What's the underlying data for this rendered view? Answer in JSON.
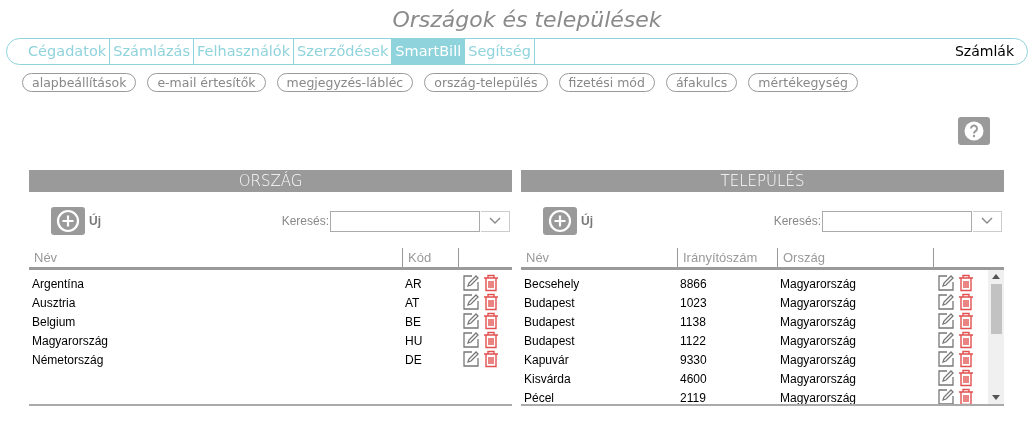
{
  "title": "Országok és települések",
  "tabs": [
    {
      "label": "Cégadatok",
      "selected": false
    },
    {
      "label": "Számlázás",
      "selected": false
    },
    {
      "label": "Felhasználók",
      "selected": false
    },
    {
      "label": "Szerződések",
      "selected": false
    },
    {
      "label": "SmartBill",
      "selected": true
    },
    {
      "label": "Segítség",
      "selected": false
    }
  ],
  "account_label": "Számlák",
  "subtabs": [
    {
      "label": "alapbeállítások"
    },
    {
      "label": "e-mail értesítők"
    },
    {
      "label": "megjegyzés-lábléc"
    },
    {
      "label": "ország-település"
    },
    {
      "label": "fizetési mód"
    },
    {
      "label": "áfakulcs"
    },
    {
      "label": "mértékegység"
    }
  ],
  "panels": [
    {
      "title": "ORSZÁG",
      "add_label": "Új",
      "search_label": "Keresés:",
      "scrollable": false,
      "columns": [
        "Név",
        "Kód"
      ],
      "rows": [
        [
          "Argentína",
          "AR"
        ],
        [
          "Ausztria",
          "AT"
        ],
        [
          "Belgium",
          "BE"
        ],
        [
          "Magyarország",
          "HU"
        ],
        [
          "Németország",
          "DE"
        ]
      ]
    },
    {
      "title": "TELEPÜLÉS",
      "add_label": "Új",
      "search_label": "Keresés:",
      "scrollable": true,
      "columns": [
        "Név",
        "Irányítószám",
        "Ország"
      ],
      "rows": [
        [
          "Becsehely",
          "8866",
          "Magyarország"
        ],
        [
          "Budapest",
          "1023",
          "Magyarország"
        ],
        [
          "Budapest",
          "1138",
          "Magyarország"
        ],
        [
          "Budapest",
          "1122",
          "Magyarország"
        ],
        [
          "Kapuvár",
          "9330",
          "Magyarország"
        ],
        [
          "Kisvárda",
          "4600",
          "Magyarország"
        ],
        [
          "Pécel",
          "2119",
          "Magyarország"
        ]
      ]
    }
  ]
}
